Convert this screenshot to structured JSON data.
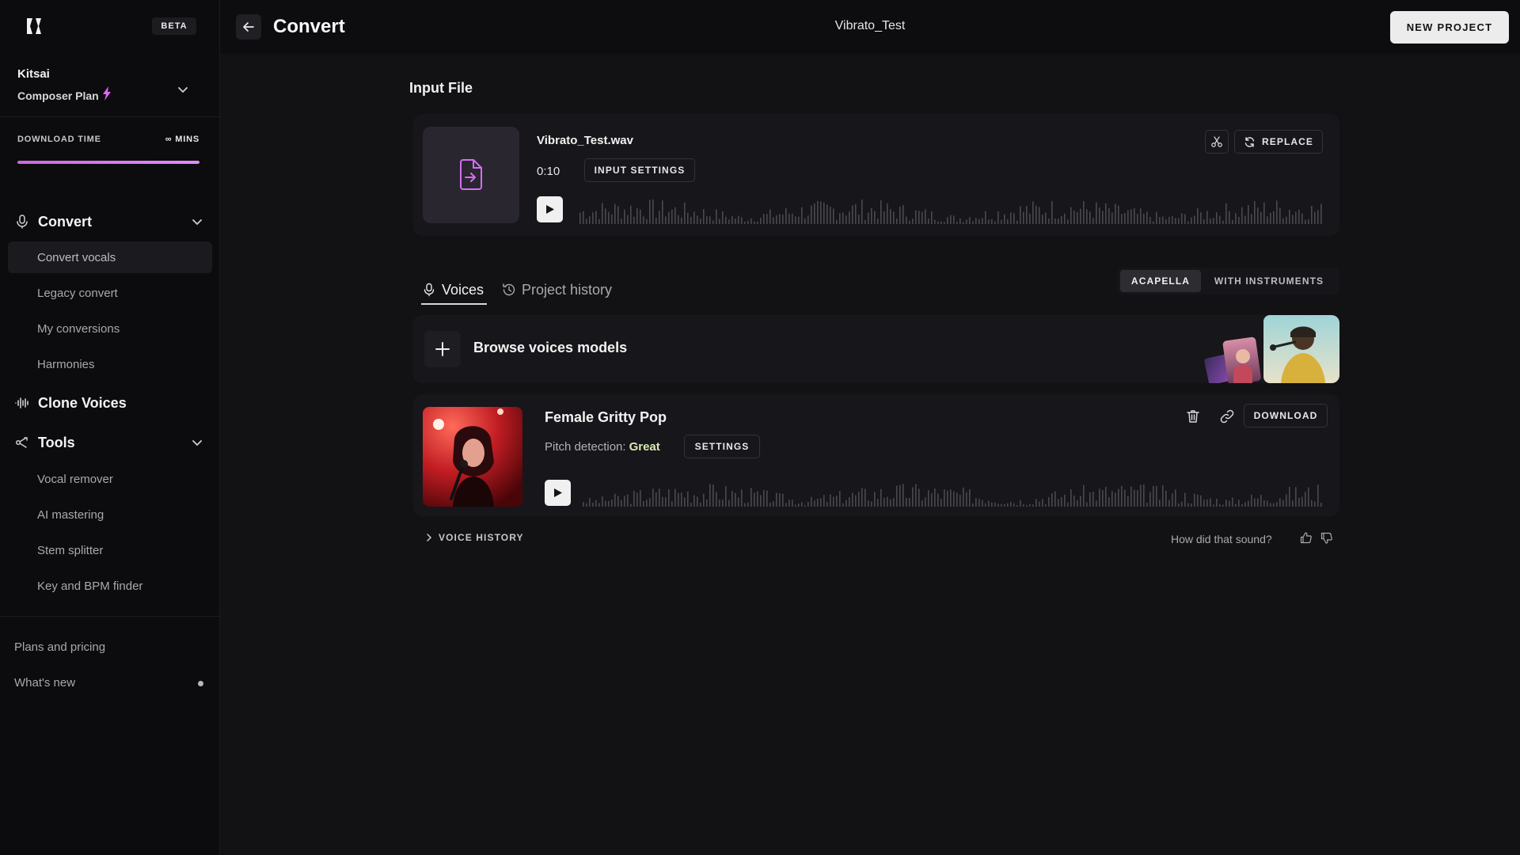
{
  "app": {
    "beta_badge": "BETA"
  },
  "account": {
    "name": "Kitsai",
    "plan": "Composer Plan"
  },
  "download_time": {
    "label": "DOWNLOAD TIME",
    "value": "∞ MINS",
    "progress_fraction": 1.0
  },
  "sidebar": {
    "sections": [
      {
        "label": "Convert",
        "icon": "microphone-icon",
        "expanded": true,
        "items": [
          {
            "label": "Convert vocals",
            "active": true
          },
          {
            "label": "Legacy convert",
            "active": false
          },
          {
            "label": "My conversions",
            "active": false
          },
          {
            "label": "Harmonies",
            "active": false
          }
        ]
      },
      {
        "label": "Clone Voices",
        "icon": "waveform-icon",
        "expanded": false,
        "items": []
      },
      {
        "label": "Tools",
        "icon": "tools-icon",
        "expanded": true,
        "items": [
          {
            "label": "Vocal remover",
            "active": false
          },
          {
            "label": "AI mastering",
            "active": false
          },
          {
            "label": "Stem splitter",
            "active": false
          },
          {
            "label": "Key and BPM finder",
            "active": false
          }
        ]
      }
    ],
    "footer": [
      {
        "label": "Plans and pricing"
      },
      {
        "label": "What's new",
        "has_dot": true
      }
    ]
  },
  "header": {
    "title": "Convert",
    "project_name": "Vibrato_Test",
    "new_project_label": "NEW PROJECT"
  },
  "input_file": {
    "section_title": "Input File",
    "file_name": "Vibrato_Test.wav",
    "duration": "0:10",
    "settings_label": "INPUT SETTINGS",
    "replace_label": "REPLACE"
  },
  "tabs": [
    {
      "label": "Voices",
      "active": true
    },
    {
      "label": "Project history",
      "active": false
    }
  ],
  "mode": {
    "options": [
      "ACAPELLA",
      "WITH INSTRUMENTS"
    ],
    "selected": "ACAPELLA"
  },
  "browse": {
    "label": "Browse voices models"
  },
  "voice_result": {
    "name": "Female Gritty Pop",
    "pitch_label": "Pitch detection:",
    "pitch_value": "Great",
    "settings_label": "SETTINGS",
    "download_label": "DOWNLOAD"
  },
  "voice_history": {
    "label": "VOICE HISTORY"
  },
  "feedback": {
    "prompt": "How did that sound?"
  },
  "colors": {
    "background": "#121114",
    "sidebar": "#0c0b0d",
    "card": "#17161a",
    "accent": "#e08bff",
    "pitch_good": "#d9e9b5"
  }
}
